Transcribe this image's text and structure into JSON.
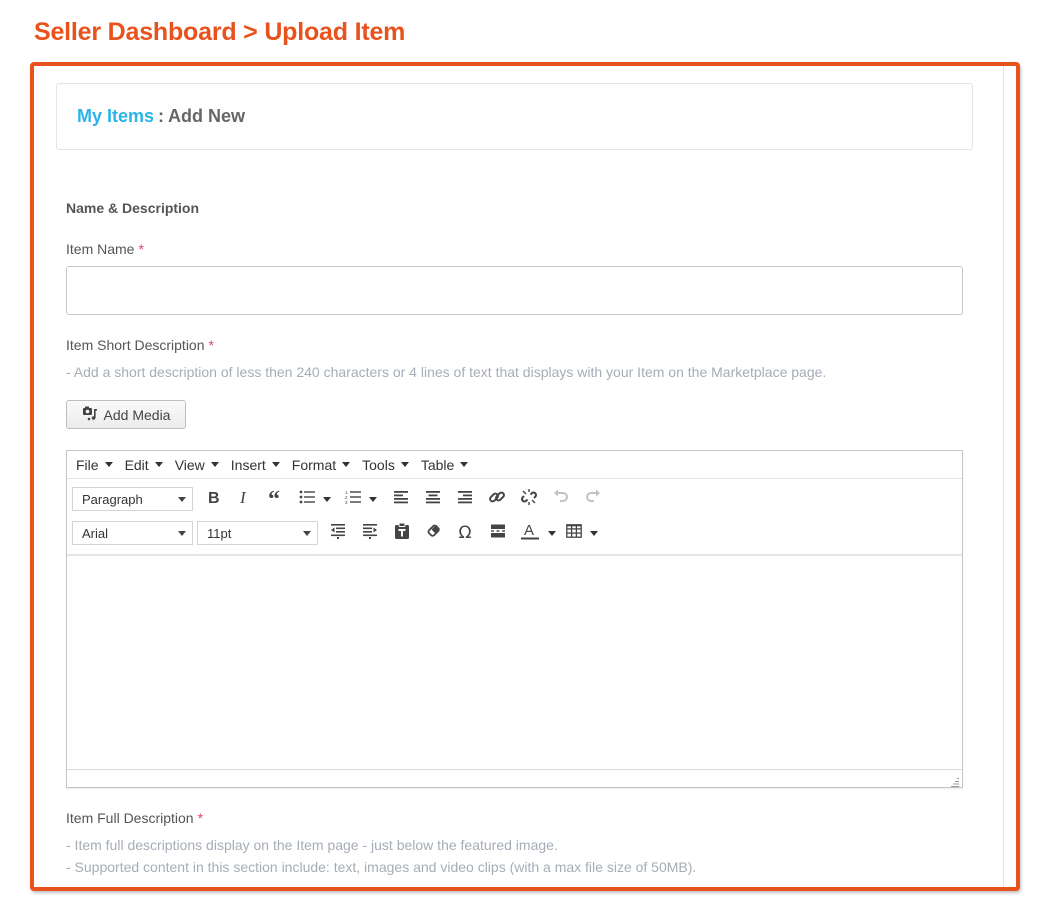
{
  "page": {
    "heading": "Seller Dashboard > Upload Item",
    "accent_color": "#e8521c"
  },
  "breadcrumb": {
    "link_label": "My Items",
    "separator": ":",
    "current": "Add New",
    "link_color": "#2ab4ea"
  },
  "form": {
    "section_title": "Name & Description",
    "required_marker": "*",
    "item_name": {
      "label": "Item Name",
      "value": "",
      "placeholder": ""
    },
    "short_description": {
      "label": "Item Short Description",
      "help": "- Add a short description of less then 240 characters or 4 lines of text that displays with your Item on the Marketplace page.",
      "add_media_label": "Add Media"
    },
    "full_description": {
      "label": "Item Full Description",
      "help_lines": [
        "- Item full descriptions display on the Item page - just below the featured image.",
        "- Supported content in this section include: text, images and video clips (with a max file size of 50MB)."
      ]
    }
  },
  "editor": {
    "menus": [
      "File",
      "Edit",
      "View",
      "Insert",
      "Format",
      "Tools",
      "Table"
    ],
    "block_format": "Paragraph",
    "font_family": "Arial",
    "font_size": "11pt",
    "content": "",
    "toolbar_row1_icons": [
      "bold-icon",
      "italic-icon",
      "blockquote-icon",
      "bullet-list-icon",
      "numbered-list-icon",
      "align-left-icon",
      "align-center-icon",
      "align-right-icon",
      "link-icon",
      "unlink-icon",
      "undo-icon",
      "redo-icon"
    ],
    "toolbar_row2_icons": [
      "outdent-icon",
      "indent-icon",
      "paste-text-icon",
      "clear-formatting-icon",
      "special-character-icon",
      "horizontal-rule-icon",
      "text-color-icon",
      "table-icon"
    ]
  }
}
